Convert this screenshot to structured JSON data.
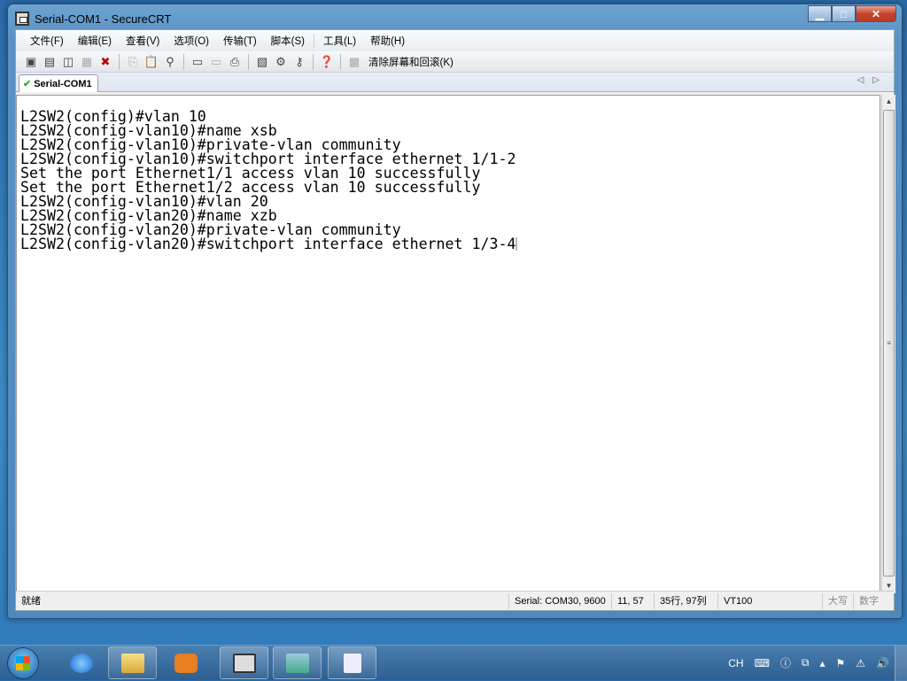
{
  "window": {
    "title": "Serial-COM1 - SecureCRT",
    "min": "▁",
    "max": "□",
    "close": "✕"
  },
  "menu": [
    "文件(F)",
    "编辑(E)",
    "查看(V)",
    "选项(O)",
    "传输(T)",
    "脚本(S)",
    "工具(L)",
    "帮助(H)"
  ],
  "toolbar": {
    "clear_label": "清除屏幕和回滚(K)"
  },
  "tab": {
    "label": "Serial-COM1",
    "nav": "◁▷"
  },
  "terminal": {
    "lines": [
      "L2SW2(config)#vlan 10",
      "L2SW2(config-vlan10)#name xsb",
      "L2SW2(config-vlan10)#private-vlan community",
      "L2SW2(config-vlan10)#switchport interface ethernet 1/1-2",
      "Set the port Ethernet1/1 access vlan 10 successfully",
      "Set the port Ethernet1/2 access vlan 10 successfully",
      "L2SW2(config-vlan10)#vlan 20",
      "L2SW2(config-vlan20)#name xzb",
      "L2SW2(config-vlan20)#private-vlan community",
      "L2SW2(config-vlan20)#switchport interface ethernet 1/3-4"
    ]
  },
  "status": {
    "ready": "就绪",
    "serial": "Serial: COM30, 9600",
    "cursor": "11,  57",
    "size": "35行, 97列",
    "emulation": "VT100",
    "caps": "大写",
    "num": "数字"
  },
  "tray": {
    "lang": "CH"
  }
}
